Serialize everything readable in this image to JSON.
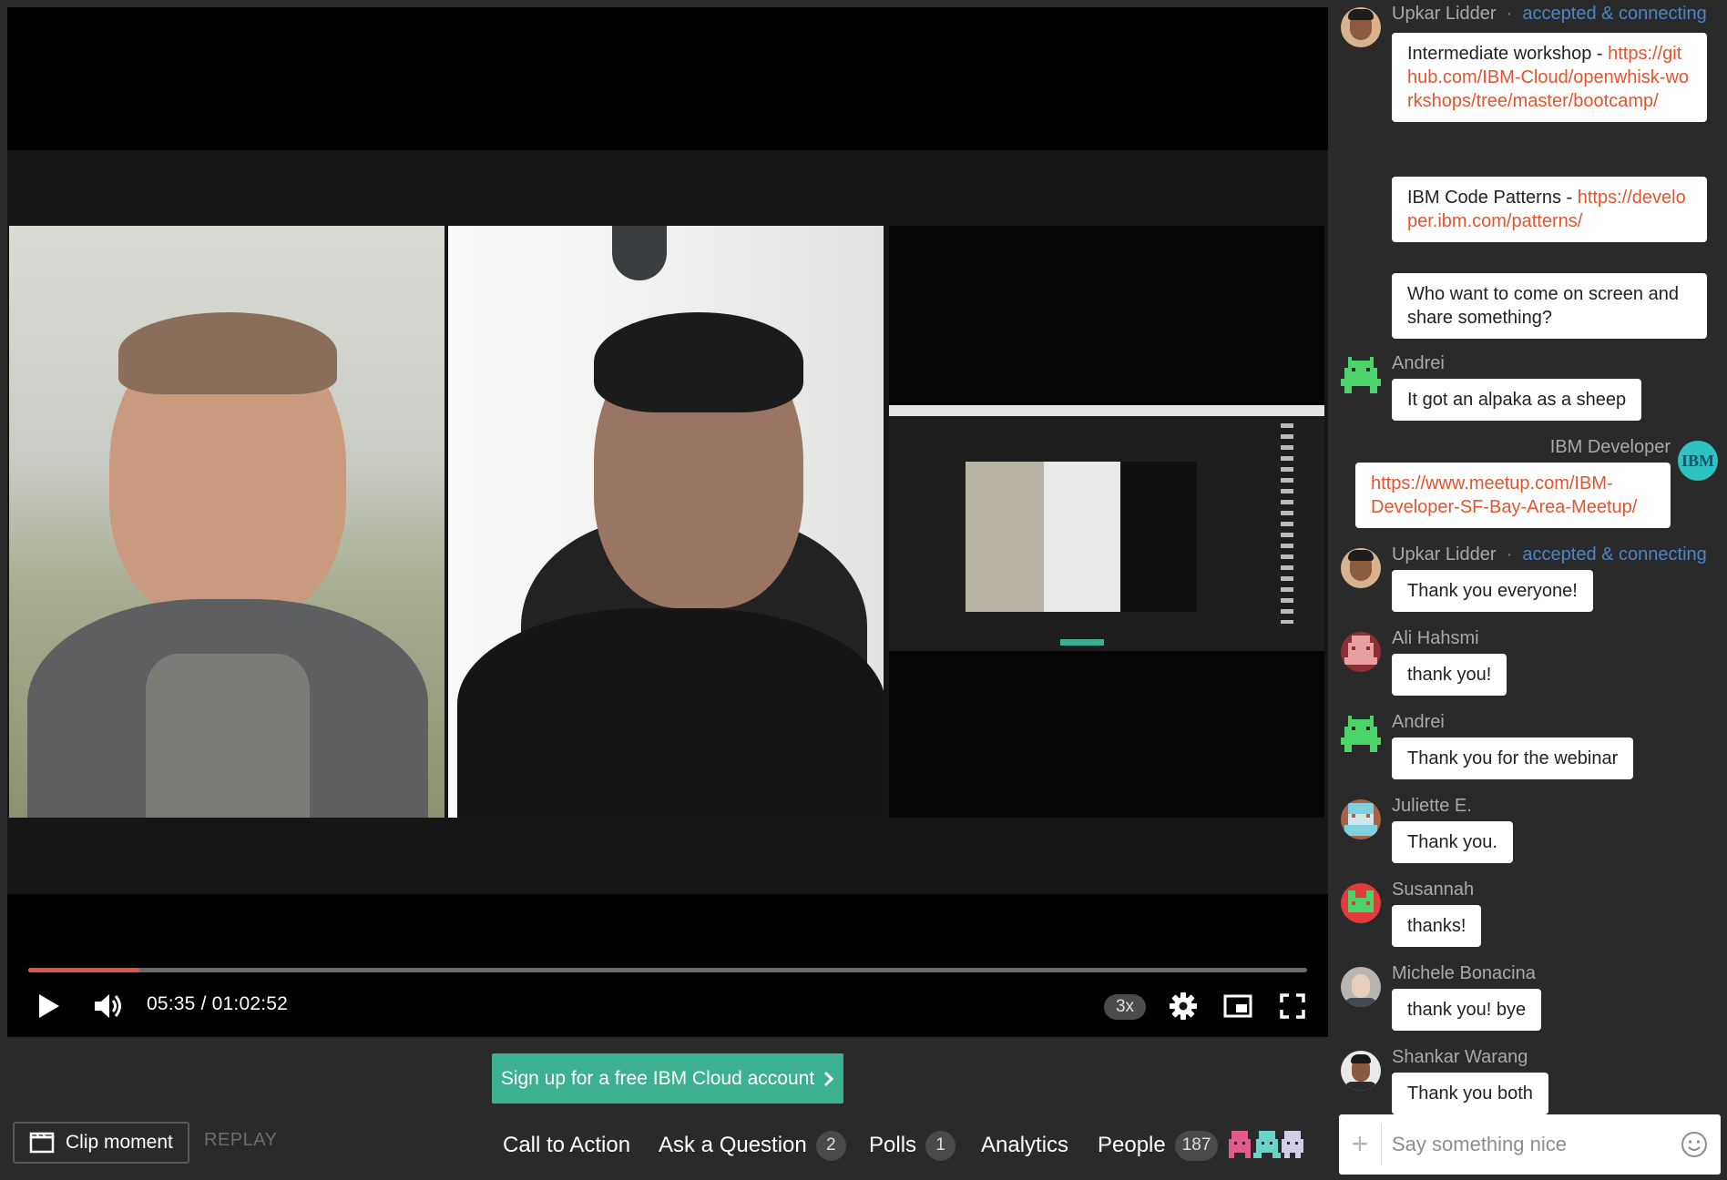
{
  "video": {
    "progress": 0.087,
    "time": "05:35 / 01:02:52",
    "speed": "3x"
  },
  "cta_button": "Sign up for a free IBM Cloud account",
  "toolbar": {
    "clip_label": "Clip moment",
    "replay_label": "REPLAY",
    "tabs": [
      {
        "label": "Call to Action"
      },
      {
        "label": "Ask a Question",
        "count": "2"
      },
      {
        "label": "Polls",
        "count": "1"
      },
      {
        "label": "Analytics"
      },
      {
        "label": "People",
        "count": "187"
      }
    ]
  },
  "chat": {
    "messages": [
      {
        "author": "Upkar Lidder",
        "status": "accepted & connecting",
        "text": "Intermediate workshop - ",
        "link": "https://github.com/IBM-Cloud/openwhisk-workshops/tree/master/bootcamp/"
      },
      {
        "text": "IBM Code Patterns - ",
        "link": "https://developer.ibm.com/patterns/"
      },
      {
        "text": "Who want to come on screen and share something?"
      },
      {
        "author": "Andrei",
        "text": "It got an alpaka as a sheep"
      },
      {
        "author": "IBM Developer",
        "avatar_text": "IBM",
        "link": "https://www.meetup.com/IBM-Developer-SF-Bay-Area-Meetup/"
      },
      {
        "author": "Upkar Lidder",
        "status": "accepted & connecting",
        "text": "Thank you everyone!"
      },
      {
        "author": "Ali Hahsmi",
        "text": "thank you!"
      },
      {
        "author": "Andrei",
        "text": "Thank you for the webinar"
      },
      {
        "author": "Juliette E.",
        "text": "Thank you."
      },
      {
        "author": "Susannah",
        "text": "thanks!"
      },
      {
        "author": "Michele Bonacina",
        "text": "thank you! bye"
      },
      {
        "author": "Shankar Warang",
        "text": "Thank you both"
      }
    ],
    "input_placeholder": "Say something nice"
  },
  "colors": {
    "accent": "#3cb191",
    "progress": "#e4573f",
    "link": "#e5532f",
    "status": "#4d84c4"
  }
}
